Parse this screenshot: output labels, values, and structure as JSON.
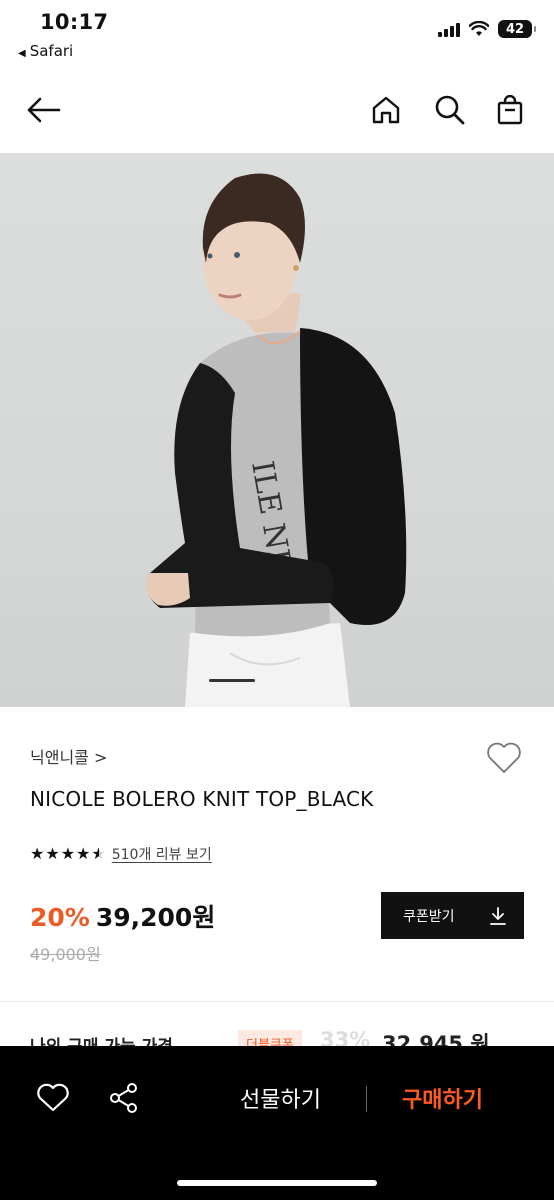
{
  "status_bar": {
    "time": "10:17",
    "back_app": "Safari",
    "battery": "42"
  },
  "header": {
    "icons": [
      "back-arrow-icon",
      "home-icon",
      "search-icon",
      "shopping-bag-icon"
    ]
  },
  "product": {
    "brand": "닉앤니콜",
    "brand_chevron": ">",
    "title": "NICOLE BOLERO KNIT TOP_BLACK",
    "rating": 4.5,
    "review_link": "510개 리뷰 보기",
    "discount": "20%",
    "price": "39,200원",
    "original_price": "49,000원",
    "coupon_button": "쿠폰받기"
  },
  "my_price_row": {
    "label": "나의 구매 가능 가격",
    "badge": "더블쿠폰",
    "percent": "33%",
    "amount": "32,945 원"
  },
  "bottom_bar": {
    "gift_label": "선물하기",
    "buy_label": "구매하기"
  },
  "colors": {
    "accent": "#ee5a26",
    "buy": "#ff5a1f",
    "bottom_bg": "#000000"
  }
}
